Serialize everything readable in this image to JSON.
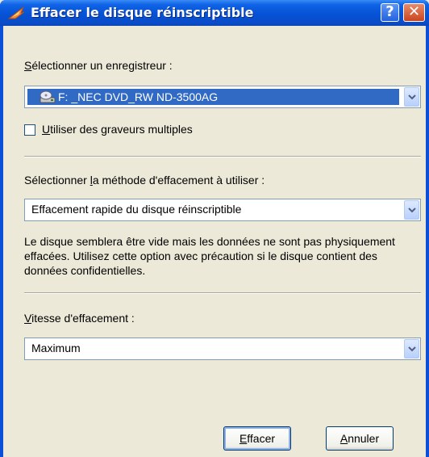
{
  "window": {
    "title": "Effacer le disque réinscriptible",
    "help_button": "?",
    "close_button": "✕"
  },
  "recorder": {
    "label_mnemonic": "S",
    "label_rest": "électionner un enregistreur :",
    "selected": "F: _NEC DVD_RW ND-3500AG",
    "multiple_label_mnemonic": "U",
    "multiple_label_rest": "tiliser des graveurs multiples",
    "multiple_checked": false
  },
  "method": {
    "label_before": "Sélectionner ",
    "label_mnemonic": "l",
    "label_after": "a méthode d'effacement à utiliser :",
    "selected": "Effacement rapide du disque réinscriptible",
    "description": "Le disque semblera être vide mais les données ne sont pas physiquement effacées. Utilisez cette option avec précaution si le disque contient des données confidentielles."
  },
  "speed": {
    "label_mnemonic": "V",
    "label_rest": "itesse d'effacement :",
    "selected": "Maximum"
  },
  "buttons": {
    "erase_mnemonic": "E",
    "erase_rest": "ffacer",
    "cancel_mnemonic": "A",
    "cancel_rest": "nnuler"
  },
  "colors": {
    "titlebar": "#0552d6",
    "selection": "#316ac5",
    "dialog_bg": "#ece9d8"
  }
}
